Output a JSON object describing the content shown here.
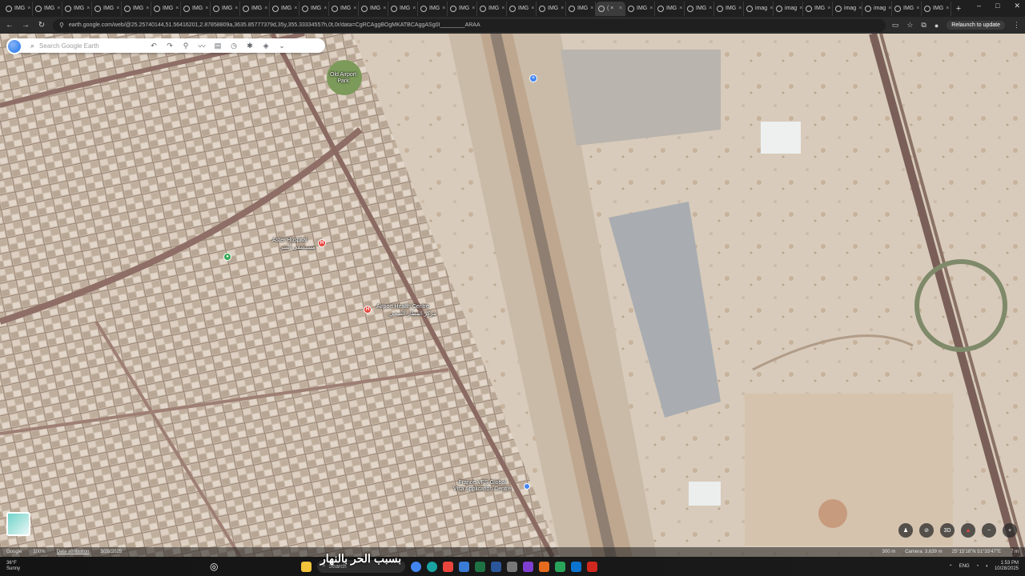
{
  "browser": {
    "tabs": [
      {
        "label": "IMG"
      },
      {
        "label": "IMG"
      },
      {
        "label": "IMG"
      },
      {
        "label": "IMG"
      },
      {
        "label": "IMG"
      },
      {
        "label": "IMG"
      },
      {
        "label": "IMG"
      },
      {
        "label": "IMG"
      },
      {
        "label": "IMG"
      },
      {
        "label": "IMG"
      },
      {
        "label": "IMG"
      },
      {
        "label": "IMG"
      },
      {
        "label": "IMG"
      },
      {
        "label": "IMG"
      },
      {
        "label": "IMG"
      },
      {
        "label": "IMG"
      },
      {
        "label": "IMG"
      },
      {
        "label": "IMG"
      },
      {
        "label": "IMG"
      },
      {
        "label": "IMG"
      },
      {
        "label": "( ×",
        "active": true
      },
      {
        "label": "IMG"
      },
      {
        "label": "IMG"
      },
      {
        "label": "IMG"
      },
      {
        "label": "IMG"
      },
      {
        "label": "imag"
      },
      {
        "label": "imag"
      },
      {
        "label": "IMG"
      },
      {
        "label": "imag"
      },
      {
        "label": "imag"
      },
      {
        "label": "IMG"
      },
      {
        "label": "IMG"
      }
    ],
    "new_tab": "+",
    "window_controls": {
      "minimize": "–",
      "maximize": "□",
      "close": "✕"
    },
    "url": "earth.google.com/web/@25.25740144,51.56416201,2.87858809a,3635.85777379d,35y,355.33334557h,0t,0r/data=CgRCAggBOgMKATBCAggASg0I________ARAA",
    "relaunch_label": "Relaunch to update"
  },
  "earth": {
    "search_placeholder": "Search Google Earth",
    "tools": [
      "undo-icon",
      "redo-icon",
      "placemark-icon",
      "path-icon",
      "measure-icon",
      "history-icon",
      "voyager-icon",
      "layers-icon",
      "chevron-down-icon"
    ]
  },
  "map_labels": {
    "old_airport_park": "Old Airport\nPark",
    "aster_hospital": "Aster Hospital",
    "aster_hospital_ar": "مستشفى أستر",
    "airport_health": "Airport Health Centre",
    "airport_health_ar": "مركز المطار الصحي",
    "visa_centre": "France VFS Global\nVisa Application Centre"
  },
  "status_bar": {
    "brand": "Google",
    "zoom": "100%",
    "data_attribution": "Data attribution",
    "date": "3/28/2025",
    "scale": "300 m",
    "camera": "Camera: 3,639 m",
    "coords": "25°15'18\"N 51°33'47\"E",
    "elevation": "7 m"
  },
  "map_controls": [
    "pegman-icon",
    "hide-icon",
    "3D",
    "compass-icon",
    "zoom-out-icon",
    "zoom-in-icon"
  ],
  "taskbar": {
    "weather_temp": "36°F",
    "weather_desc": "Sunny",
    "search_label": "Search",
    "overlay_text": "بسبب الحر بالنهار",
    "tray_lang": "ENG",
    "time": "1:53 PM",
    "date": "10/28/2025"
  }
}
